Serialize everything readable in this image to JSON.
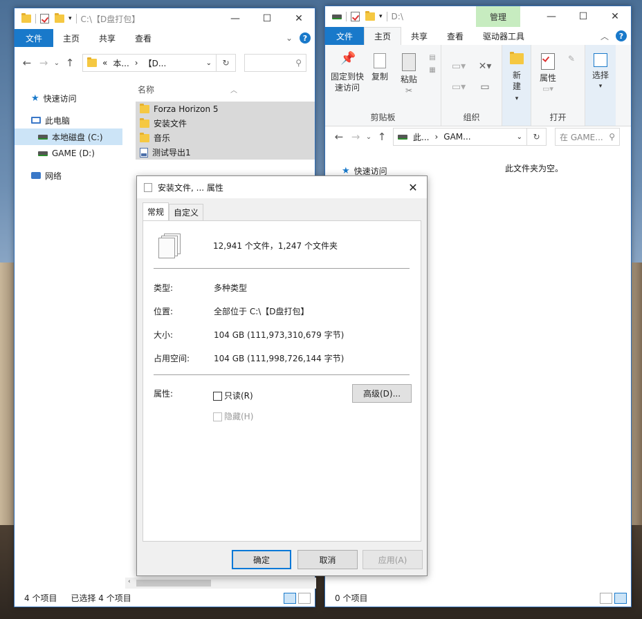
{
  "left_window": {
    "title": "C:\\【D盘打包】",
    "menu": [
      "文件",
      "主页",
      "共享",
      "查看"
    ],
    "address": [
      "«",
      "本...",
      "›",
      "【D..."
    ],
    "column_header": "名称",
    "nav": [
      "快速访问",
      "此电脑",
      "本地磁盘 (C:)",
      "GAME (D:)",
      "网络"
    ],
    "files": [
      "Forza Horizon 5",
      "安装文件",
      "音乐",
      "测试导出1"
    ],
    "status_count": "4 个项目",
    "status_selected": "已选择 4 个项目"
  },
  "right_window": {
    "title": "D:\\",
    "manage_tab": "管理",
    "menu": [
      "文件",
      "主页",
      "共享",
      "查看",
      "驱动器工具"
    ],
    "ribbon": {
      "pin": "固定到快速访问",
      "copy": "复制",
      "paste": "粘贴",
      "clipboard": "剪贴板",
      "organize": "组织",
      "new": "新建",
      "properties": "属性",
      "open": "打开",
      "select": "选择"
    },
    "address": [
      "此...",
      "›",
      "GAM..."
    ],
    "search_placeholder": "在 GAME...",
    "nav_quick": "快速访问",
    "empty_text": "此文件夹为空。",
    "status_count": "0 个项目"
  },
  "dialog": {
    "title": "安装文件, ... 属性",
    "tabs": [
      "常规",
      "自定义"
    ],
    "summary": "12,941 个文件，1,247 个文件夹",
    "rows": [
      {
        "k": "类型:",
        "v": "多种类型"
      },
      {
        "k": "位置:",
        "v": "全部位于 C:\\【D盘打包】"
      },
      {
        "k": "大小:",
        "v": "104 GB (111,973,310,679 字节)"
      },
      {
        "k": "占用空间:",
        "v": "104 GB (111,998,726,144 字节)"
      }
    ],
    "attr_label": "属性:",
    "readonly": "只读(R)",
    "hidden": "隐藏(H)",
    "advanced": "高级(D)...",
    "ok": "确定",
    "cancel": "取消",
    "apply": "应用(A)"
  },
  "colors": {
    "accent": "#1979ca",
    "selection": "#cce4f7",
    "manage": "#c7ecc0"
  }
}
